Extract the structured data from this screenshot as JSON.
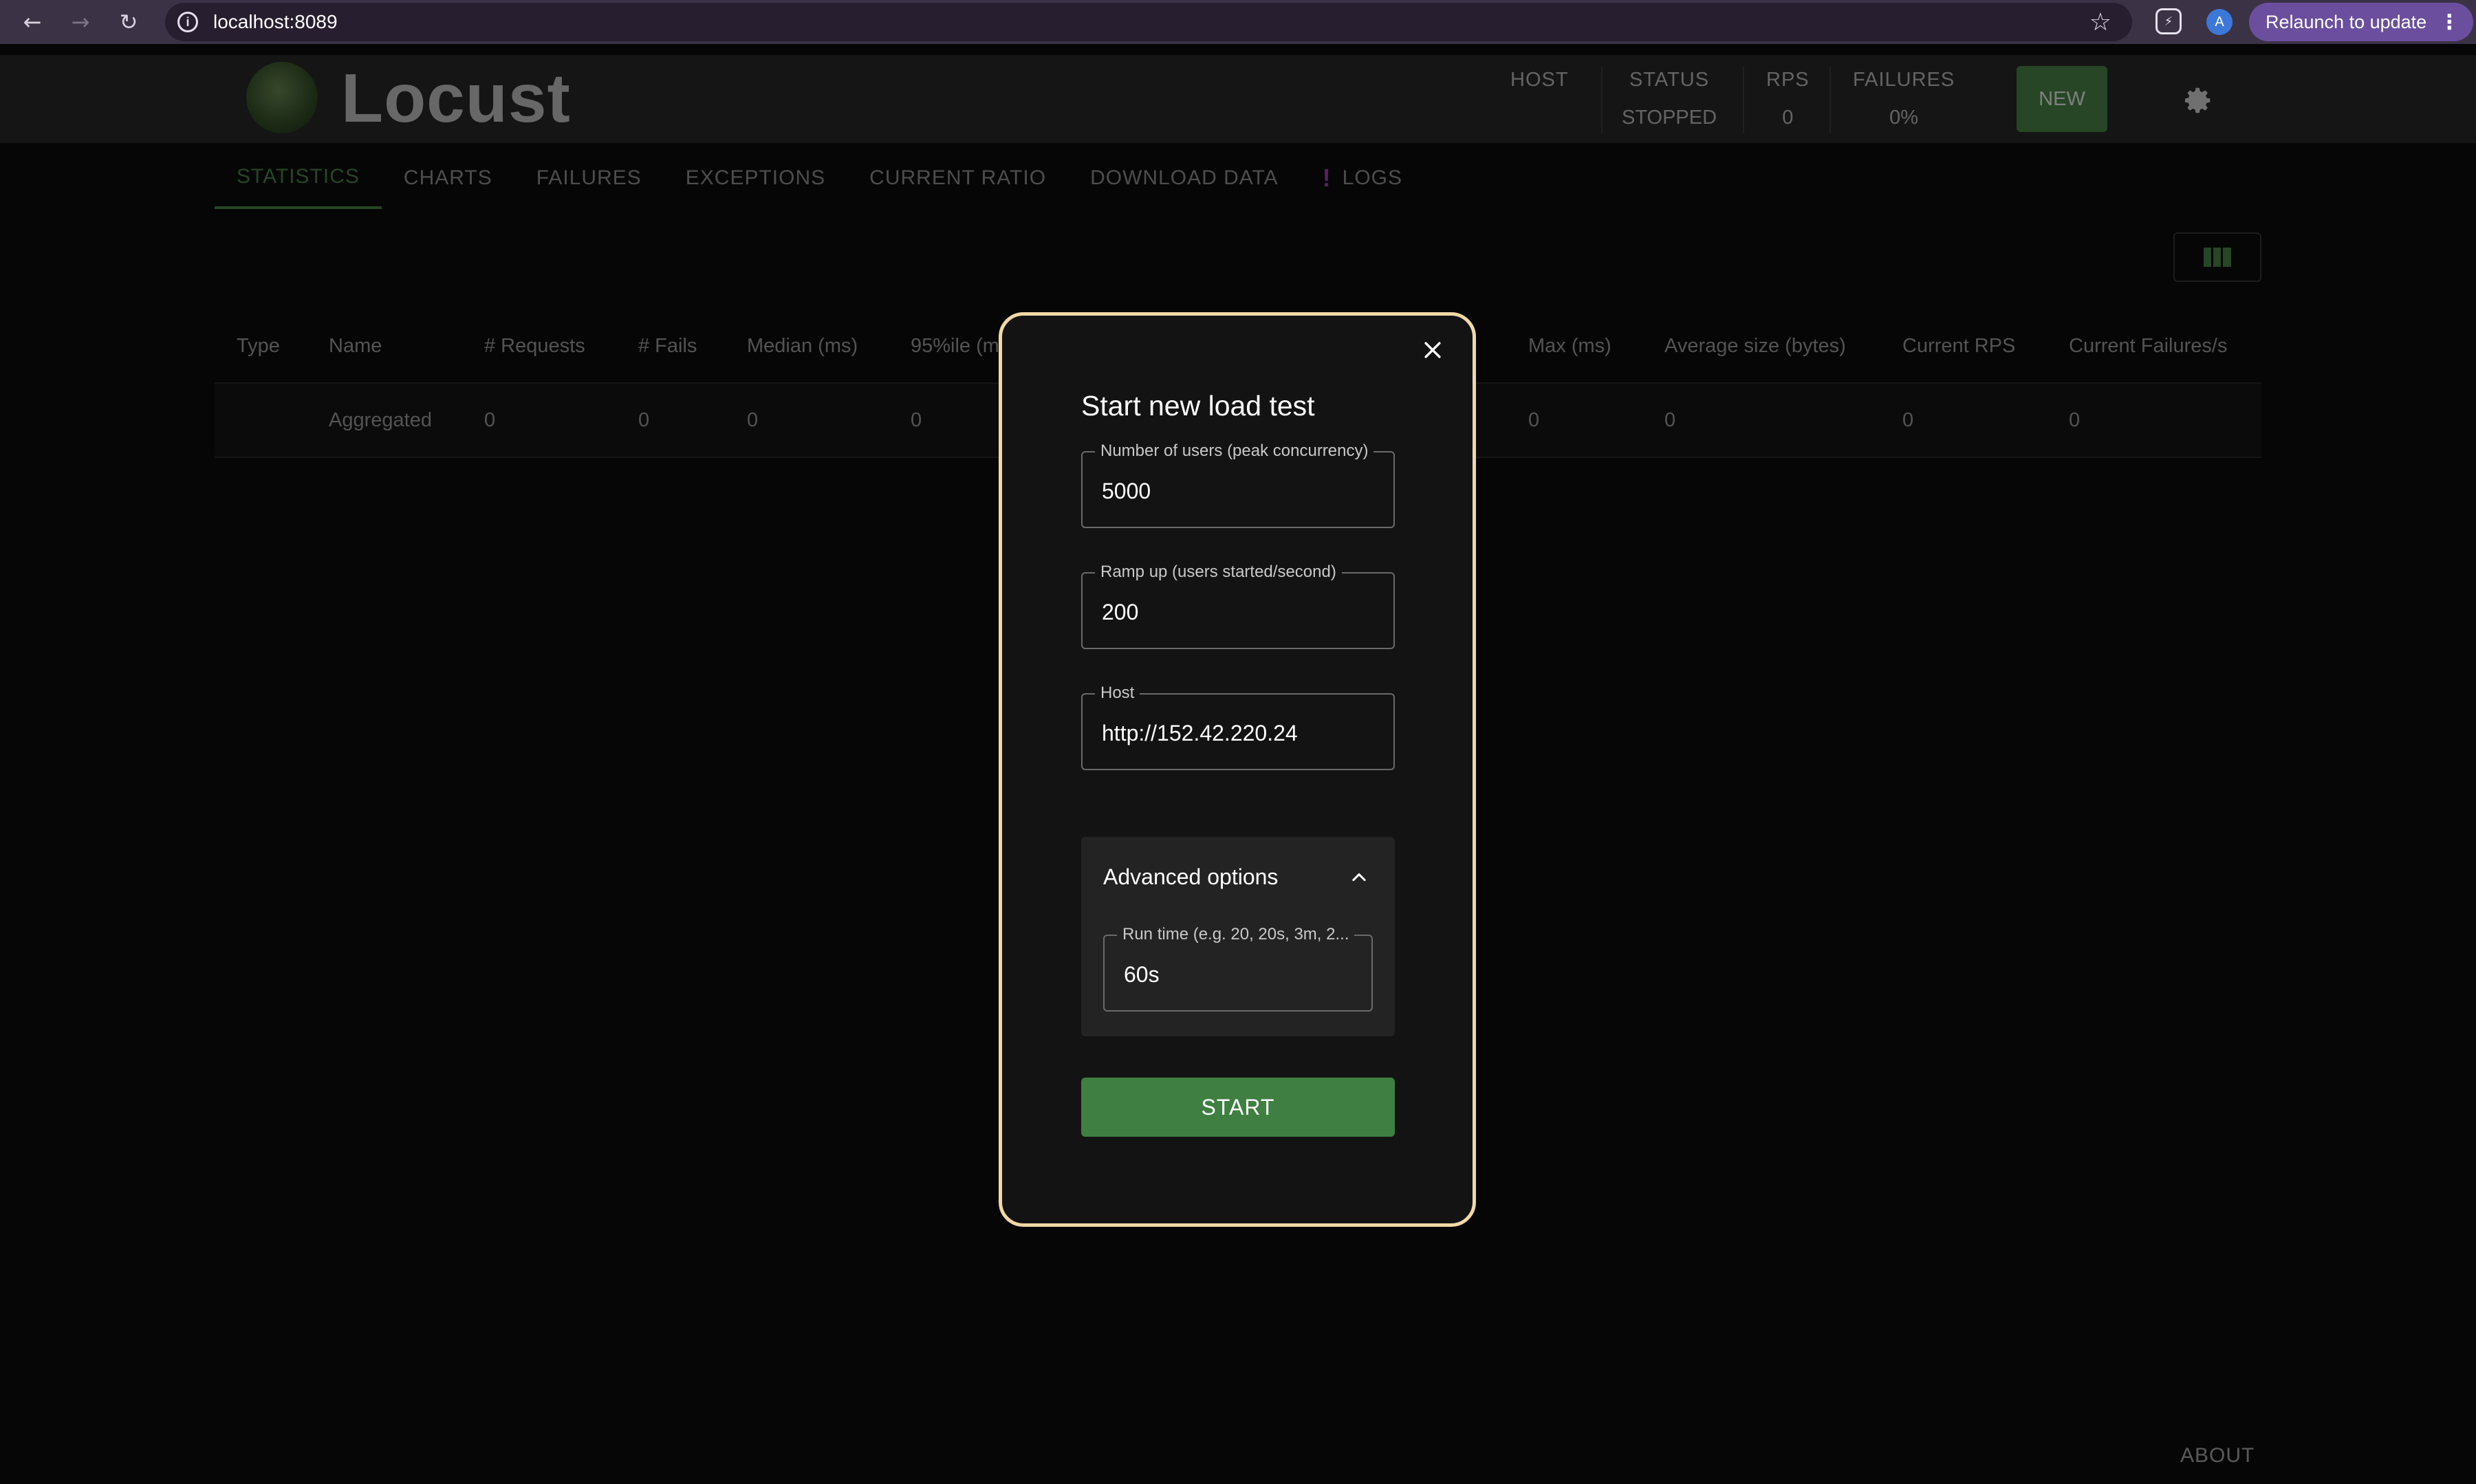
{
  "browser": {
    "url": "localhost:8089",
    "profile_initial": "A",
    "relaunch_label": "Relaunch to update"
  },
  "header": {
    "app_name": "Locust",
    "host_label": "HOST",
    "status_label": "STATUS",
    "status_value": "STOPPED",
    "rps_label": "RPS",
    "rps_value": "0",
    "failures_label": "FAILURES",
    "failures_value": "0%",
    "new_button": "NEW"
  },
  "tabs": [
    {
      "label": "STATISTICS",
      "active": true
    },
    {
      "label": "CHARTS"
    },
    {
      "label": "FAILURES"
    },
    {
      "label": "EXCEPTIONS"
    },
    {
      "label": "CURRENT RATIO"
    },
    {
      "label": "DOWNLOAD DATA"
    },
    {
      "label": "LOGS",
      "warn": "!"
    }
  ],
  "table": {
    "headers": [
      "Type",
      "Name",
      "# Requests",
      "# Fails",
      "Median (ms)",
      "95%ile (m",
      "Max (ms)",
      "Average size (bytes)",
      "Current RPS",
      "Current Failures/s"
    ],
    "rows": [
      [
        "",
        "Aggregated",
        "0",
        "0",
        "0",
        "0",
        "0",
        "0",
        "0",
        "0"
      ]
    ]
  },
  "modal": {
    "title": "Start new load test",
    "users_label": "Number of users (peak concurrency)",
    "users_value": "5000",
    "rampup_label": "Ramp up (users started/second)",
    "rampup_value": "200",
    "host_label": "Host",
    "host_value": "http://152.42.220.24",
    "advanced_label": "Advanced options",
    "runtime_label": "Run time (e.g. 20, 20s, 3m, 2...",
    "runtime_value": "60s",
    "start_button": "START"
  },
  "footer": {
    "about_link": "ABOUT"
  },
  "colors": {
    "accent_green": "#4c8c4a",
    "modal_border": "#f1d9a6",
    "warn_purple": "#b83cc8",
    "browser_bar": "#3b3245"
  }
}
